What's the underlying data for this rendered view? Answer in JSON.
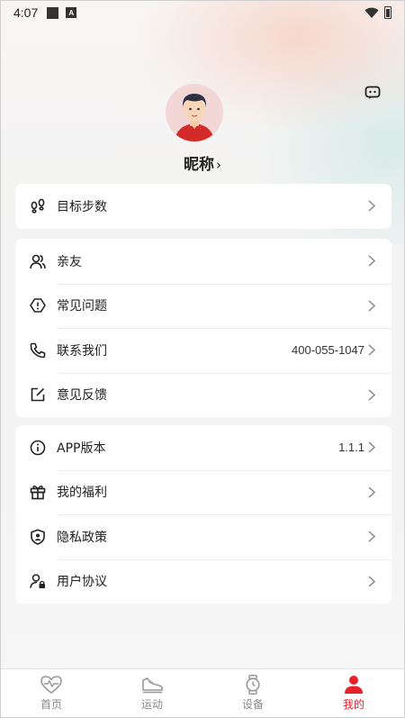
{
  "status_bar": {
    "time": "4:07",
    "notif_letter": "A"
  },
  "profile": {
    "nickname": "昵称"
  },
  "goal_card": {
    "label": "目标步数"
  },
  "menu_group_1": [
    {
      "label": "亲友",
      "value": ""
    },
    {
      "label": "常见问题",
      "value": ""
    },
    {
      "label": "联系我们",
      "value": "400-055-1047"
    },
    {
      "label": "意见反馈",
      "value": ""
    }
  ],
  "menu_group_2": [
    {
      "label": "APP版本",
      "value": "1.1.1"
    },
    {
      "label": "我的福利",
      "value": ""
    },
    {
      "label": "隐私政策",
      "value": ""
    },
    {
      "label": "用户协议",
      "value": ""
    }
  ],
  "tabbar": [
    {
      "label": "首页",
      "icon": "heart-pulse-icon",
      "active": false
    },
    {
      "label": "运动",
      "icon": "sneaker-icon",
      "active": false
    },
    {
      "label": "设备",
      "icon": "watch-icon",
      "active": false
    },
    {
      "label": "我的",
      "icon": "person-icon",
      "active": true
    }
  ],
  "colors": {
    "accent": "#e8212a",
    "card": "#ffffff",
    "background": "#f6f6f6"
  }
}
